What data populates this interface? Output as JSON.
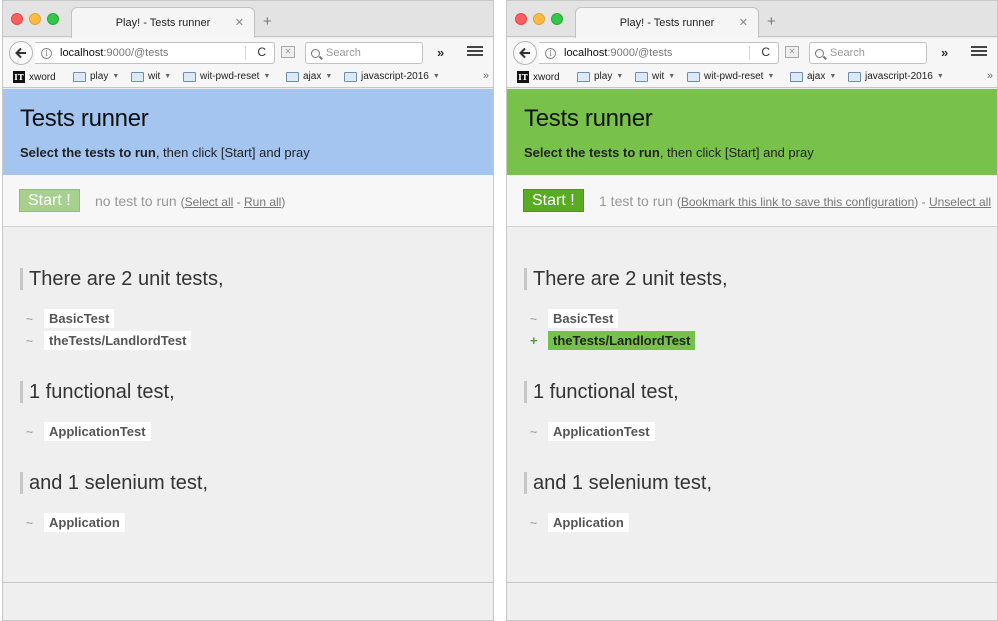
{
  "windows": [
    {
      "browser": {
        "tab_title": "Play! - Tests runner",
        "url_host": "localhost",
        "url_path": ":9000/@tests",
        "search_placeholder": "Search",
        "bookmarks": [
          {
            "label": "xword",
            "icon": "it-icon"
          },
          {
            "label": "play",
            "icon": "folder-icon"
          },
          {
            "label": "wit",
            "icon": "folder-icon"
          },
          {
            "label": "wit-pwd-reset",
            "icon": "folder-icon"
          },
          {
            "label": "ajax",
            "icon": "folder-icon"
          },
          {
            "label": "javascript-2016",
            "icon": "folder-icon"
          }
        ]
      },
      "header": {
        "title": "Tests runner",
        "subtitle_bold": "Select the tests to run",
        "subtitle_rest": ", then click [Start] and pray",
        "color": "#a4c5f0"
      },
      "controls": {
        "start_label": "Start !",
        "start_enabled": false,
        "count_text": "no test to run",
        "link1": "Select all",
        "link2": "Run all"
      },
      "sections": [
        {
          "title": "There are 2 unit tests,",
          "tests": [
            {
              "name": "BasicTest",
              "selected": false
            },
            {
              "name": "theTests/LandlordTest",
              "selected": false
            }
          ]
        },
        {
          "title": "1 functional test,",
          "tests": [
            {
              "name": "ApplicationTest",
              "selected": false
            }
          ]
        },
        {
          "title": "and 1 selenium test,",
          "tests": [
            {
              "name": "Application",
              "selected": false
            }
          ]
        }
      ]
    },
    {
      "browser": {
        "tab_title": "Play! - Tests runner",
        "url_host": "localhost",
        "url_path": ":9000/@tests",
        "search_placeholder": "Search",
        "bookmarks": [
          {
            "label": "xword",
            "icon": "it-icon"
          },
          {
            "label": "play",
            "icon": "folder-icon"
          },
          {
            "label": "wit",
            "icon": "folder-icon"
          },
          {
            "label": "wit-pwd-reset",
            "icon": "folder-icon"
          },
          {
            "label": "ajax",
            "icon": "folder-icon"
          },
          {
            "label": "javascript-2016",
            "icon": "folder-icon"
          }
        ]
      },
      "header": {
        "title": "Tests runner",
        "subtitle_bold": "Select the tests to run",
        "subtitle_rest": ", then click [Start] and pray",
        "color": "#78c24c"
      },
      "controls": {
        "start_label": "Start !",
        "start_enabled": true,
        "count_text": "1 test to run",
        "link1": "Bookmark this link to save this configuration",
        "link2": "Unselect all"
      },
      "sections": [
        {
          "title": "There are 2 unit tests,",
          "tests": [
            {
              "name": "BasicTest",
              "selected": false
            },
            {
              "name": "theTests/LandlordTest",
              "selected": true
            }
          ]
        },
        {
          "title": "1 functional test,",
          "tests": [
            {
              "name": "ApplicationTest",
              "selected": false
            }
          ]
        },
        {
          "title": "and 1 selenium test,",
          "tests": [
            {
              "name": "Application",
              "selected": false
            }
          ]
        }
      ]
    }
  ]
}
